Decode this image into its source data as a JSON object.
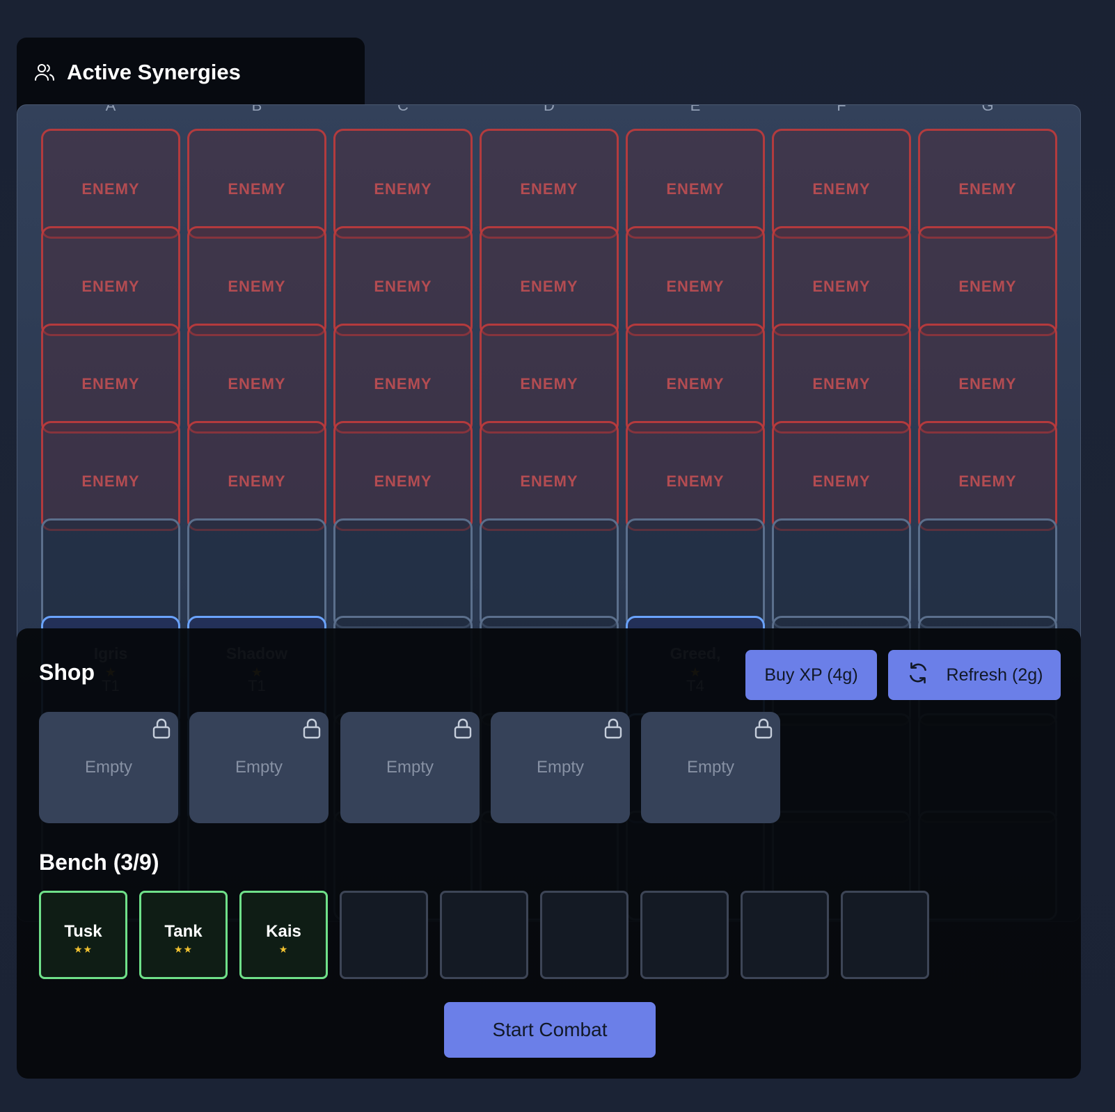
{
  "synergies": {
    "title": "Active Synergies",
    "icon": "users-icon"
  },
  "board": {
    "columns": [
      "A",
      "B",
      "C",
      "D",
      "E",
      "F",
      "G"
    ],
    "enemy_label": "ENEMY",
    "units": [
      {
        "col": "A",
        "name": "Igris",
        "stars": "★",
        "tier": "T1"
      },
      {
        "col": "B",
        "name": "Shadow",
        "stars": "★",
        "tier": "T1"
      },
      {
        "col": "E",
        "name": "Greed,",
        "stars": "★",
        "tier": "T4"
      }
    ]
  },
  "shop": {
    "title": "Shop",
    "buy_xp_label": "Buy XP (4g)",
    "refresh_label": "Refresh (2g)",
    "slots": [
      "Empty",
      "Empty",
      "Empty",
      "Empty",
      "Empty"
    ]
  },
  "bench": {
    "title": "Bench (3/9)",
    "units": [
      {
        "name": "Tusk",
        "stars": "★★"
      },
      {
        "name": "Tank",
        "stars": "★★"
      },
      {
        "name": "Kais",
        "stars": "★"
      }
    ]
  },
  "start_label": "Start Combat",
  "colors": {
    "accent": "#6b7fe8",
    "enemy": "#c83c3c",
    "bench_border": "#6fe089",
    "star": "#f2c230"
  }
}
